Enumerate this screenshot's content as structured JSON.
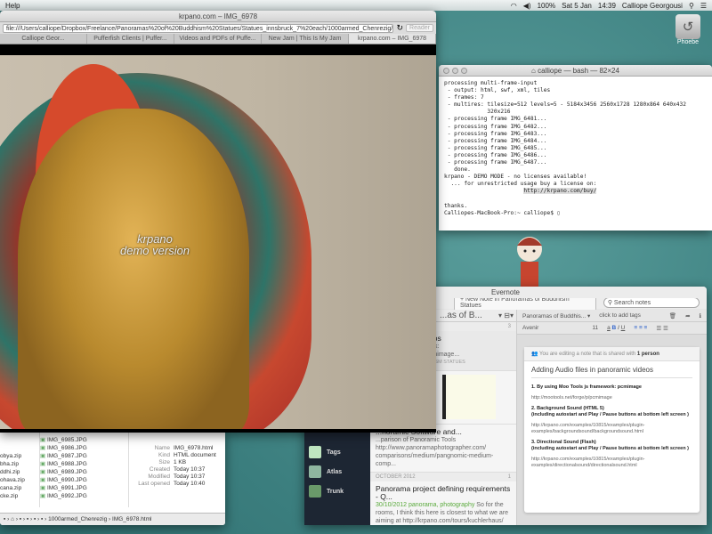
{
  "menubar": {
    "app_menu": "Help",
    "battery": "100%",
    "date": "Sat 5 Jan",
    "time": "14:39",
    "user": "Calliope Georgousi"
  },
  "desktop": {
    "drive_label": "Phoebe"
  },
  "browser": {
    "title": "krpano.com – IMG_6978",
    "url": "file:///Users/calliope/Dropbox/Freelance/Panoramas%20of%20Buddhism%20Statues/Statues_innsbruck_7%20each/1000armed_Chenrezig/IMG",
    "reader": "Reader",
    "tabs": [
      "Calliope Geor...",
      "Pufferfish Clients | Puffer...",
      "Videos and PDFs of Puffe...",
      "New Jam | This Is My Jam",
      "krpano.com – IMG_6978"
    ],
    "overlay_line1": "krpano",
    "overlay_line2": "demo version",
    "controls": [
      "+",
      "−",
      "◀",
      "▶",
      "▲",
      "▼",
      "⤢"
    ]
  },
  "terminal": {
    "title": "calliope — bash — 82×24",
    "lines": [
      "",
      "processing multi-frame-input",
      " - output: html, swf, xml, tiles",
      " - frames: 7",
      " - multires: tilesize=512 levels=5 - 5184x3456 2560x1728 1280x864 640x432",
      "             320x216",
      " - processing frame IMG_6481...",
      " - processing frame IMG_6482...",
      " - processing frame IMG_6483...",
      " - processing frame IMG_6484...",
      " - processing frame IMG_6485...",
      " - processing frame IMG_6486...",
      " - processing frame IMG_6487...",
      "   done.",
      "",
      "",
      "krpano - DEMO MODE - no licenses available!",
      "  ... for unrestricted usage buy a license on:",
      ""
    ],
    "link": "http://krpano.com/buy/",
    "thanks": "thanks.",
    "prompt": "Calliopes-MacBook-Pro:~ calliope$ "
  },
  "evernote": {
    "title": "Evernote",
    "new_note": "+ New Note in Panoramas of Buddhism Statues",
    "search_placeholder": "Search notes",
    "notebook_short": "...as of B...",
    "list_count": "3",
    "sidebar": [
      "Tags",
      "Atlas",
      "Trunk"
    ],
    "notes": [
      {
        "title": "...panoramic videos",
        "body": "...o Tools js framework: ...ools.net/forge/p/pcmimage...",
        "meta": "PANORAMAS OF BUDDHISM STATUES"
      },
      {
        "title": "...noramic Software and...",
        "body": "...parison of Panoramic Tools http://www.panoramaphotographer.com/ comparisons/medium/pangnomic-medium-comp..."
      }
    ],
    "month_header": "OCTOBER 2012",
    "month_count": "1",
    "note3": {
      "title": "Panorama project defining requirements -  Q...",
      "date": "30/10/2012",
      "tags": "panorama, photography",
      "body": "So for the rooms, I think this here is closest to what we are aiming at http://krpano.com/tours/kuchlerhaus/ (e..."
    },
    "editor": {
      "notebook": "Panoramas of Buddhis... ▾",
      "tags": "click to add tags",
      "font": "Avenir",
      "size": "11",
      "shared": "You are editing a note that is shared with",
      "shared_count": "1 person",
      "note_title": "Adding Audio files in panoramic videos",
      "h1": "1. By using Moo Tools js framework: pcmimage",
      "l1": "http://mootools.net/forge/p/pcmimage",
      "h2": "2. Background Sound (HTML 5)",
      "h2b": "(including autostart and Play / Pause buttons at bottom left screen )",
      "l2": "http://krpano.com/examples/10815/examples/plugin-examples/backgroundsound/backgroundsound.html",
      "h3": "3. Directional Sound (Flash)",
      "h3b": "(including autostart and Play / Pause buttons at bottom left screen )",
      "l3": "http://krpano.com/examples/10815/examples/plugin-examples/directionalsound/directionalsound.html"
    }
  },
  "finder": {
    "zips": [
      "obya.zip",
      "bha.zip",
      "ddhi.zip",
      "ohava.zip",
      "cana.zip",
      "cke.zip"
    ],
    "files": [
      "IMG_6985.JPG",
      "IMG_6986.JPG",
      "IMG_6987.JPG",
      "IMG_6988.JPG",
      "IMG_6989.JPG",
      "IMG_6990.JPG",
      "IMG_6991.JPG",
      "IMG_6992.JPG"
    ],
    "info": [
      [
        "Name",
        "IMG_6978.html"
      ],
      [
        "Kind",
        "HTML document"
      ],
      [
        "Size",
        "1 KB"
      ],
      [
        "Created",
        "Today 10:37"
      ],
      [
        "Modified",
        "Today 10:37"
      ],
      [
        "Last opened",
        "Today 10:40"
      ]
    ],
    "path_folder": "1000armed_Chenrezig",
    "path_file": "IMG_6978.html"
  }
}
